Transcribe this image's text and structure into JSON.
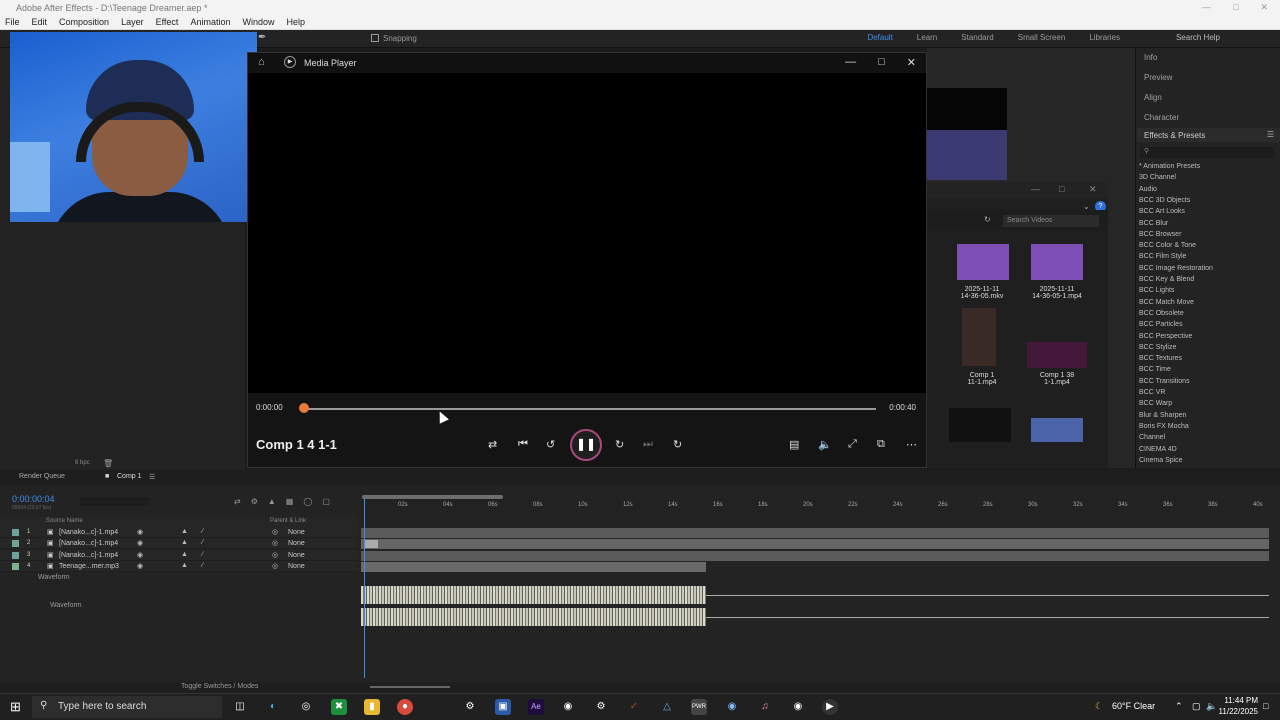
{
  "app": {
    "title": "Adobe After Effects - D:\\Teenage Dreamer.aep *",
    "menu": [
      "File",
      "Edit",
      "Composition",
      "Layer",
      "Effect",
      "Animation",
      "Window",
      "Help"
    ],
    "snapping_label": "Snapping",
    "workspaces": [
      "Default",
      "Learn",
      "Standard",
      "Small Screen",
      "Libraries"
    ],
    "active_workspace": "Default",
    "search_help": "Search Help"
  },
  "media_player": {
    "title": "Media Player",
    "time_current": "0:00:00",
    "time_total": "0:00:40",
    "progress_fraction": 0.0,
    "clip_title": "Comp 1 4 1-1",
    "state": "playing"
  },
  "right_panel": {
    "headers": [
      "Info",
      "Preview",
      "Align",
      "Character"
    ],
    "effects_title": "Effects & Presets",
    "effects": [
      "* Animation Presets",
      "3D Channel",
      "Audio",
      "BCC 3D Objects",
      "BCC Art Looks",
      "BCC Blur",
      "BCC Browser",
      "BCC Color & Tone",
      "BCC Film Style",
      "BCC Image Restoration",
      "BCC Key & Blend",
      "BCC Lights",
      "BCC Match Move",
      "BCC Obsolete",
      "BCC Particles",
      "BCC Perspective",
      "BCC Stylize",
      "BCC Textures",
      "BCC Time",
      "BCC Transitions",
      "BCC VR",
      "BCC Warp",
      "Blur & Sharpen",
      "Boris FX Mocha",
      "Channel",
      "CINEMA 4D",
      "Cinema Spice"
    ]
  },
  "browser": {
    "search_placeholder": "Search Videos",
    "items": [
      {
        "label1": "2025-11-11",
        "label2": "14-36-05.mkv"
      },
      {
        "label1": "2025-11-11",
        "label2": "14-36-05-1.mp4"
      },
      {
        "label1": "Comp 1",
        "label2": "11-1.mp4"
      },
      {
        "label1": "Comp 1 38",
        "label2": "1-1.mp4"
      }
    ]
  },
  "timeline": {
    "render_queue_tab": "Render Queue",
    "comp_tab": "Comp 1",
    "timecode": "0:00:00:04",
    "fps": "00004 (29.97 fps)",
    "bpc": "8 bpc",
    "ticks": [
      "02s",
      "04s",
      "06s",
      "08s",
      "10s",
      "12s",
      "14s",
      "16s",
      "18s",
      "20s",
      "22s",
      "24s",
      "26s",
      "28s",
      "30s",
      "32s",
      "34s",
      "36s",
      "38s",
      "40s"
    ],
    "col_source": "Source Name",
    "col_parent": "Parent & Link",
    "layers": [
      {
        "num": "1",
        "name": "[Nanako...c]-1.mp4",
        "parent": "None"
      },
      {
        "num": "2",
        "name": "[Nanako...c]-1.mp4",
        "parent": "None"
      },
      {
        "num": "3",
        "name": "[Nanako...c]-1.mp4",
        "parent": "None"
      },
      {
        "num": "4",
        "name": "Teenage...mer.mp3",
        "parent": "None"
      }
    ],
    "waveform_label": "Waveform",
    "waveform_sub": "Waveform",
    "toggle_label": "Toggle Switches / Modes"
  },
  "taskbar": {
    "search_placeholder": "Type here to search",
    "weather": "60°F  Clear",
    "time": "11:44 PM",
    "date": "11/22/2025"
  }
}
